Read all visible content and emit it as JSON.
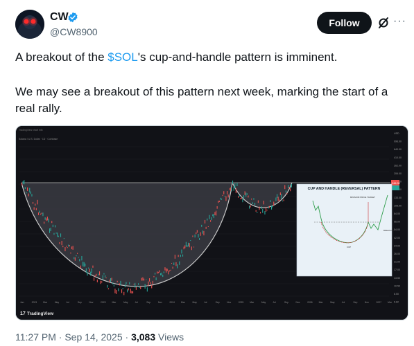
{
  "author": {
    "name": "CW",
    "handle": "@CW8900"
  },
  "follow_label": "Follow",
  "tweet": {
    "line1_before": "A breakout of the ",
    "cashtag": "$SOL",
    "line1_after": "'s cup-and-handle pattern is imminent.",
    "line2": "We may see a breakout of this pattern next week, marking the start of a real rally."
  },
  "chart": {
    "x_labels": [
      "Jan",
      "2023",
      "Mar",
      "May",
      "Jul",
      "Sep",
      "Nov",
      "2023",
      "Mar",
      "May",
      "Jul",
      "Sep",
      "Nov",
      "2024",
      "Mar",
      "May",
      "Jul",
      "Sep",
      "Nov",
      "2025",
      "Mar",
      "May",
      "Jul",
      "Sep",
      "Nov",
      "2026",
      "Mar",
      "May",
      "Jul",
      "Sep",
      "Nov",
      "2027",
      "Mar"
    ],
    "price_labels": [
      "USD",
      "996.00",
      "640.00",
      "410.00",
      "262.00",
      "206.00",
      "173.00",
      "150.00",
      "133.00",
      "105.00",
      "84.00",
      "66.00",
      "54.00",
      "42.00",
      "34.00",
      "26.00",
      "21.00",
      "17.00",
      "13.50",
      "10.50",
      "8.50",
      "6.82"
    ],
    "current_price": "246.00",
    "inset_title": "CUP AND HANDLE (REVERSAL) PATTERN",
    "inset_labels": {
      "target": "MINIMUM PRICE TARGET",
      "cup": "CUP",
      "breakout": "BREAKOUT"
    },
    "watermark": "TradingView",
    "colors": {
      "up": "#26a69a",
      "down": "#ef5350",
      "cup": "#c8c8c8"
    }
  },
  "footer": {
    "time": "11:27 PM · Sep 14, 2025 · ",
    "views": "3,083",
    "views_label": " Views"
  }
}
